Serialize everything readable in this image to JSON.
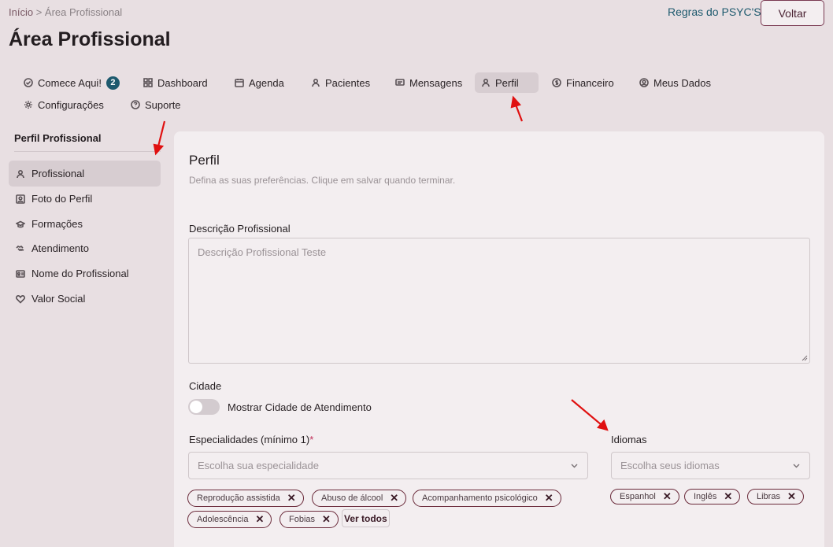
{
  "breadcrumb": {
    "home": "Início",
    "separator": ">",
    "current": "Área Profissional"
  },
  "header": {
    "title": "Área Profissional",
    "rules_link": "Regras do PSYC'S",
    "back_button": "Voltar"
  },
  "topnav": {
    "items": [
      {
        "label": "Comece Aqui!",
        "icon": "check-circle-icon",
        "badge": "2"
      },
      {
        "label": "Dashboard",
        "icon": "grid-icon"
      },
      {
        "label": "Agenda",
        "icon": "calendar-icon"
      },
      {
        "label": "Pacientes",
        "icon": "user-icon"
      },
      {
        "label": "Mensagens",
        "icon": "message-icon"
      },
      {
        "label": "Perfil",
        "icon": "user-icon",
        "active": true
      },
      {
        "label": "Financeiro",
        "icon": "dollar-circle-icon"
      },
      {
        "label": "Meus Dados",
        "icon": "user-circle-icon"
      },
      {
        "label": "Configurações",
        "icon": "gear-icon"
      },
      {
        "label": "Suporte",
        "icon": "help-circle-icon"
      }
    ]
  },
  "sidebar": {
    "title": "Perfil Profissional",
    "items": [
      {
        "label": "Profissional",
        "icon": "user-icon",
        "active": true
      },
      {
        "label": "Foto do Perfil",
        "icon": "portrait-icon"
      },
      {
        "label": "Formações",
        "icon": "graduation-cap-icon"
      },
      {
        "label": "Atendimento",
        "icon": "handshake-icon"
      },
      {
        "label": "Nome do Profissional",
        "icon": "id-card-icon"
      },
      {
        "label": "Valor Social",
        "icon": "heart-icon"
      }
    ]
  },
  "form": {
    "title": "Perfil",
    "subtitle": "Defina as suas preferências. Clique em salvar quando terminar.",
    "description_label": "Descrição Profissional",
    "description_value": "Descrição Profissional Teste",
    "city_label": "Cidade",
    "city_toggle_label": "Mostrar Cidade de Atendimento",
    "city_toggle_on": false,
    "specialties_label": "Especialidades (mínimo 1)",
    "specialties_required": "*",
    "specialties_placeholder": "Escolha sua especialidade",
    "specialties": [
      "Reprodução assistida",
      "Abuso de álcool",
      "Acompanhamento psicológico",
      "Adolescência",
      "Fobias"
    ],
    "see_all": "Ver todos",
    "languages_label": "Idiomas",
    "languages_placeholder": "Escolha seus idiomas",
    "languages": [
      "Espanhol",
      "Inglês",
      "Libras"
    ],
    "chip_remove": "✕"
  },
  "colors": {
    "accent": "#1e5a6e",
    "chip_border": "#6a2a3a",
    "background": "#e8dfe2",
    "panel": "#f3eef0",
    "annotation_arrow": "#e01010"
  }
}
